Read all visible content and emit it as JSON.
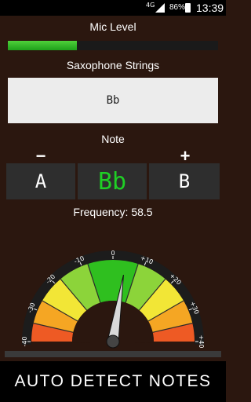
{
  "status_bar": {
    "network": "4G",
    "battery": "86%",
    "time": "13:39"
  },
  "mic_level": {
    "label": "Mic Level",
    "level_percent": 33
  },
  "instrument": {
    "label": "Saxophone Strings",
    "selected_string": "Bb"
  },
  "note": {
    "label": "Note",
    "minus_label": "−",
    "plus_label": "+",
    "prev_note": "A",
    "current_note": "Bb",
    "next_note": "B"
  },
  "frequency": {
    "text": "Frequency: 58.5"
  },
  "gauge": {
    "ticks": [
      "-40",
      "-30",
      "-20",
      "-10",
      "0",
      "+10",
      "+20",
      "+30",
      "+40"
    ],
    "needle_cents": 4,
    "colors": {
      "green": "#2fbf1f",
      "light_green": "#8cd43a",
      "yellow_green": "#d8e03a",
      "yellow": "#f2e636",
      "orange": "#f5a623",
      "red": "#ee5a24"
    }
  },
  "auto_detect": {
    "label": "AUTO DETECT NOTES"
  }
}
